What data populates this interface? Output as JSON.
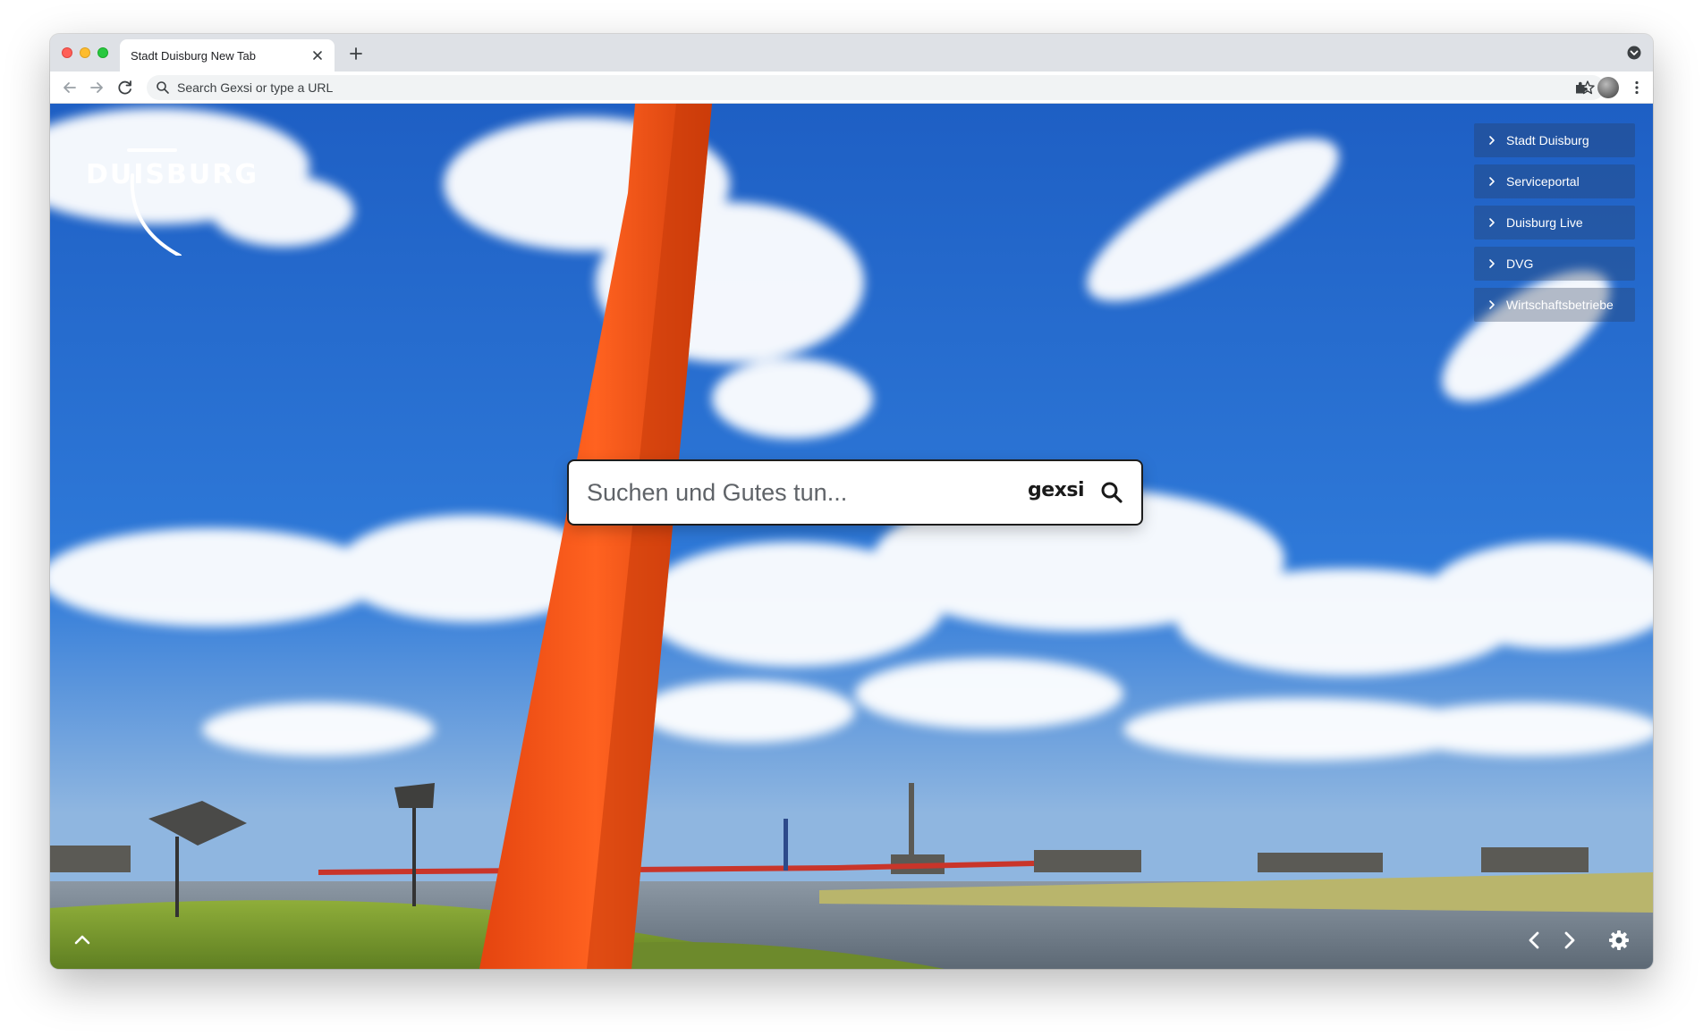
{
  "browser": {
    "tab": {
      "title": "Stadt Duisburg New Tab"
    },
    "address_bar": {
      "placeholder": "Search Gexsi or type a URL"
    }
  },
  "page": {
    "logo": {
      "text": "DUISBURG"
    },
    "quick_links": [
      {
        "label": "Stadt Duisburg"
      },
      {
        "label": "Serviceportal"
      },
      {
        "label": "Duisburg Live"
      },
      {
        "label": "DVG"
      },
      {
        "label": "Wirtschaftsbetriebe"
      }
    ],
    "search": {
      "placeholder": "Suchen und Gutes tun...",
      "brand": "gexsi"
    }
  },
  "colors": {
    "sky": "#1f6fd1",
    "sculpture": "#f25a1e",
    "white": "#ffffff"
  },
  "icons": {
    "close": "close-icon",
    "new_tab": "plus-icon",
    "back": "back-arrow-icon",
    "forward": "forward-arrow-icon",
    "reload": "reload-icon",
    "search": "search-icon",
    "star": "star-icon",
    "extensions": "puzzle-icon",
    "settings": "gear-icon"
  }
}
